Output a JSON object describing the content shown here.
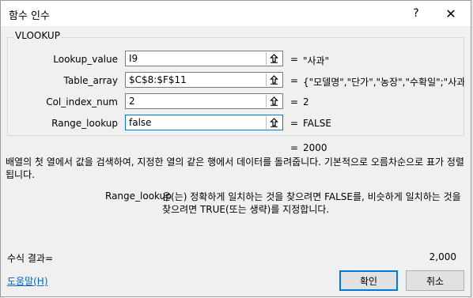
{
  "window": {
    "title": "함수 인수",
    "help_glyph": "?",
    "close_glyph": "✕"
  },
  "function": {
    "name": "VLOOKUP",
    "args": [
      {
        "label": "Lookup_value",
        "value": "I9",
        "result": "\"사과\""
      },
      {
        "label": "Table_array",
        "value": "$C$8:$F$11",
        "result": "{\"모델명\",\"단가\",\"농장\",\"수확일\";\"사과"
      },
      {
        "label": "Col_index_num",
        "value": "2",
        "result": "2"
      },
      {
        "label": "Range_lookup",
        "value": "false",
        "result": "FALSE"
      }
    ],
    "equals_glyph": "=",
    "result_value": "2000"
  },
  "description": "배열의 첫 열에서 값을 검색하여, 지정한 열의 같은 행에서 데이터를 돌려줍니다. 기본적으로 오름차순으로 표가 정렬됩니다.",
  "arg_description": {
    "name": "Range_lookup",
    "text": "은(는) 정확하게 일치하는 것을 찾으려면 FALSE를, 비슷하게 일치하는 것을 찾으려면 TRUE(또는 생략)를 지정합니다."
  },
  "formula_result": {
    "label": "수식 결과=",
    "value": "2,000"
  },
  "help_link": "도움말(H)",
  "buttons": {
    "ok": "확인",
    "cancel": "취소"
  },
  "icons": {
    "collapse": "collapse-dialog-icon"
  }
}
